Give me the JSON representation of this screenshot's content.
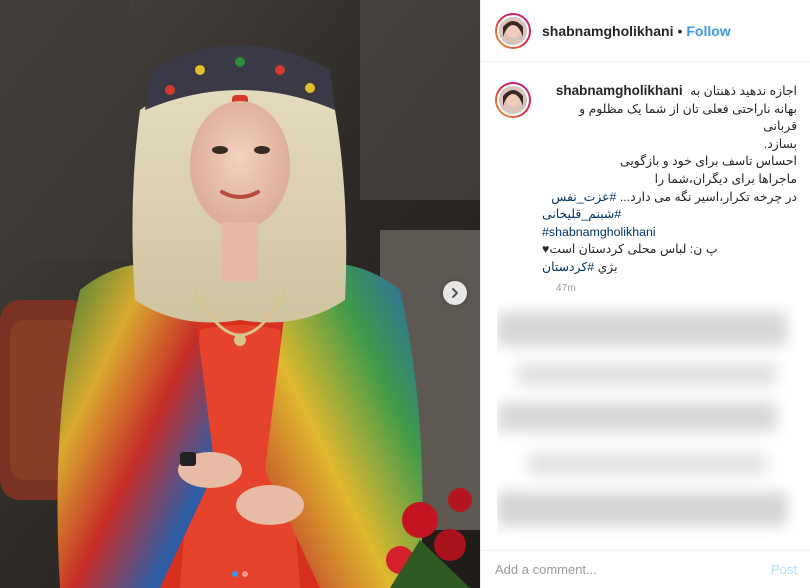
{
  "post": {
    "username": "shabnamgholikhani",
    "separator": "•",
    "follow_label": "Follow",
    "caption_lines": [
      "اجازه ندهید ذهنتان به",
      "بهانه ناراحتی فعلی تان از شما یک مظلوم و قربانی",
      "بسازد.",
      "احساس تاسف برای خود و بازگویی",
      "ماجراها برای دیگران،شما را",
      "در چرخه تکرار،اسیر نگه می دارد... "
    ],
    "hashtags": {
      "self_respect": "#عزت_نفس",
      "name_fa": "شبنم_قلیخانی#",
      "name_en": "#shabnamgholikhani",
      "kurdistan": "#کردستان"
    },
    "ps_line": "♥پ ن: لباس محلی کردستان است",
    "ps_prefix": "بژي ",
    "timestamp": "47m",
    "comment_placeholder": "Add a comment...",
    "post_label": "Post"
  },
  "carousel": {
    "slide_count": 2,
    "active_index": 1
  },
  "icons": {
    "next": "chevron-right-icon"
  },
  "colors": {
    "accent": "#3897f0",
    "hashtag": "#003569",
    "post_disabled": "#b2dffc"
  }
}
